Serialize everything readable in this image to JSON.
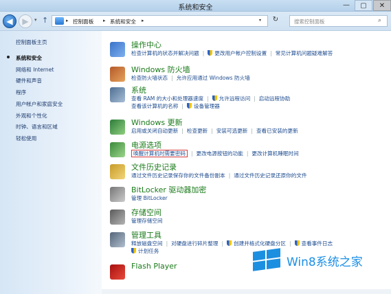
{
  "window": {
    "title": "系统和安全",
    "min": "—",
    "max": "▢",
    "close": "✕"
  },
  "nav": {
    "back": "◀",
    "forward": "▶",
    "history": "▾",
    "up": "↑",
    "breadcrumb": [
      "控制面板",
      "系统和安全"
    ],
    "separator": "▸",
    "dropdown": "▾",
    "refresh": "↻",
    "search_placeholder": "搜索控制面板",
    "search_icon": "⌕"
  },
  "sidebar": {
    "home": "控制面板主页",
    "items": [
      "系统和安全",
      "网络和 Internet",
      "硬件和声音",
      "程序",
      "用户帐户和家庭安全",
      "外观和个性化",
      "时钟、语言和区域",
      "轻松使用"
    ]
  },
  "categories": [
    {
      "title": "操作中心",
      "icon": "flag-icon",
      "lines": [
        [
          "检查计算机的状态并解决问题",
          "|",
          "S更改用户帐户控制设置",
          "|",
          "常见计算机问题疑难解答"
        ]
      ]
    },
    {
      "title": "Windows 防火墙",
      "icon": "firewall-icon",
      "lines": [
        [
          "检查防火墙状态",
          "|",
          "允许应用通过 Windows 防火墙"
        ]
      ]
    },
    {
      "title": "系统",
      "icon": "system-icon",
      "lines": [
        [
          "查看 RAM 的大小和处理器速度",
          "|",
          "S允许远程访问",
          "|",
          "启动远程协助"
        ],
        [
          "查看该计算机的名称",
          "|",
          "S设备管理器"
        ]
      ]
    },
    {
      "title": "Windows 更新",
      "icon": "update-icon",
      "lines": [
        [
          "启用或关闭自动更新",
          "|",
          "检查更新",
          "|",
          "安装可选更新",
          "|",
          "查看已安装的更新"
        ]
      ]
    },
    {
      "title": "电源选项",
      "icon": "power-icon",
      "lines": [
        [
          "H唤醒计算机时需要密码",
          "|",
          "更改电源按钮的功能",
          "|",
          "更改计算机睡眠时间"
        ]
      ]
    },
    {
      "title": "文件历史记录",
      "icon": "file-history-icon",
      "lines": [
        [
          "通过文件历史记录保存你的文件备份副本",
          "|",
          "通过文件历史记录还原你的文件"
        ]
      ]
    },
    {
      "title": "BitLocker 驱动器加密",
      "icon": "bitlocker-icon",
      "lines": [
        [
          "管理 BitLocker"
        ]
      ]
    },
    {
      "title": "存储空间",
      "icon": "storage-icon",
      "lines": [
        [
          "管理存储空间"
        ]
      ]
    },
    {
      "title": "管理工具",
      "icon": "admin-tools-icon",
      "lines": [
        [
          "释放磁盘空间",
          "|",
          "对硬盘进行碎片整理",
          "|",
          "S创建并格式化硬盘分区",
          "|",
          "S查看事件日志"
        ],
        [
          "S计划任务"
        ]
      ]
    },
    {
      "title": "Flash Player",
      "icon": "flash-icon",
      "lines": []
    }
  ],
  "watermark": {
    "text": "Win8系统之家"
  },
  "colors": {
    "link": "#1d4b8f",
    "category_title": "#1a7a1a",
    "highlight_border": "#d83a3a",
    "watermark": "#1b8fe6"
  }
}
